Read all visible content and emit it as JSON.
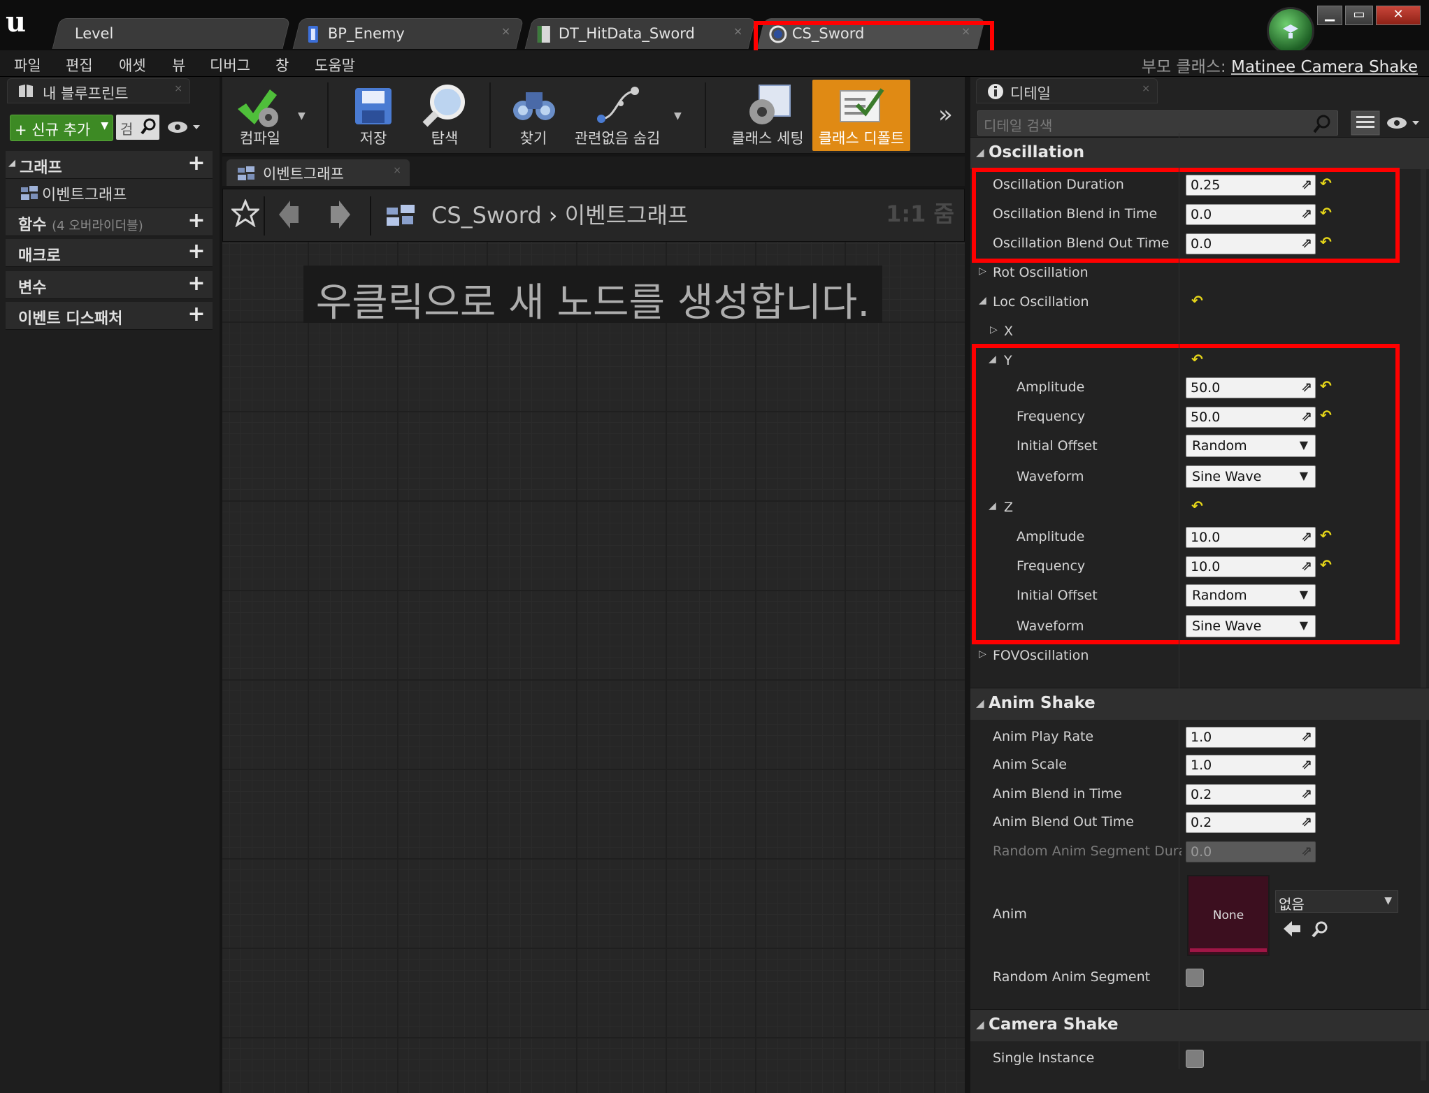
{
  "tabs": [
    {
      "label": "Level",
      "active": false
    },
    {
      "label": "BP_Enemy",
      "active": false
    },
    {
      "label": "DT_HitData_Sword",
      "active": false
    },
    {
      "label": "CS_Sword",
      "active": true
    }
  ],
  "menu": [
    "파일",
    "편집",
    "애셋",
    "뷰",
    "디버그",
    "창",
    "도움말"
  ],
  "parent_class": {
    "label": "부모 클래스:",
    "value": "Matinee Camera Shake"
  },
  "left_panel": {
    "tab_label": "내 블루프린트",
    "add_new": "+ 신규 추가",
    "search_placeholder": "검",
    "categories": [
      {
        "label": "그래프"
      },
      {
        "label": "이벤트그래프",
        "child": true
      },
      {
        "label": "함수",
        "sub": "(4 오버라이더블)"
      },
      {
        "label": "매크로"
      },
      {
        "label": "변수"
      },
      {
        "label": "이벤트 디스패처"
      }
    ]
  },
  "toolbar": [
    {
      "label": "컴파일"
    },
    {
      "label": "저장"
    },
    {
      "label": "탐색"
    },
    {
      "label": "찾기"
    },
    {
      "label": "관련없음 숨김"
    },
    {
      "label": "클래스 세팅"
    },
    {
      "label": "클래스 디폴트"
    }
  ],
  "graph": {
    "tab_label": "이벤트그래프",
    "breadcrumb_root": "CS_Sword",
    "breadcrumb_sep": "›",
    "breadcrumb_leaf": "이벤트그래프",
    "zoom": "1:1 줌",
    "hint": "우클릭으로 새 노드를 생성합니다."
  },
  "details": {
    "tab_label": "디테일",
    "search_placeholder": "디테일 검색",
    "oscillation": {
      "header": "Oscillation",
      "duration_label": "Oscillation Duration",
      "duration": "0.25",
      "blend_in_label": "Oscillation Blend in Time",
      "blend_in": "0.0",
      "blend_out_label": "Oscillation Blend Out Time",
      "blend_out": "0.0",
      "rot_label": "Rot Oscillation",
      "loc_label": "Loc Oscillation",
      "x_label": "X",
      "y_label": "Y",
      "y_amplitude_label": "Amplitude",
      "y_amplitude": "50.0",
      "y_frequency_label": "Frequency",
      "y_frequency": "50.0",
      "y_initial_offset_label": "Initial Offset",
      "y_initial_offset": "Random",
      "y_waveform_label": "Waveform",
      "y_waveform": "Sine Wave",
      "z_label": "Z",
      "z_amplitude_label": "Amplitude",
      "z_amplitude": "10.0",
      "z_frequency_label": "Frequency",
      "z_frequency": "10.0",
      "z_initial_offset_label": "Initial Offset",
      "z_initial_offset": "Random",
      "z_waveform_label": "Waveform",
      "z_waveform": "Sine Wave",
      "fov_label": "FOVOscillation"
    },
    "anim_shake": {
      "header": "Anim Shake",
      "play_rate_label": "Anim Play Rate",
      "play_rate": "1.0",
      "scale_label": "Anim Scale",
      "scale": "1.0",
      "blend_in_label": "Anim Blend in Time",
      "blend_in": "0.2",
      "blend_out_label": "Anim Blend Out Time",
      "blend_out": "0.2",
      "random_segment_duration_label": "Random Anim Segment Duratio",
      "random_segment_duration": "0.0",
      "anim_label": "Anim",
      "anim_thumb": "None",
      "anim_value": "없음",
      "random_segment_label": "Random Anim Segment"
    },
    "camera_shake": {
      "header": "Camera Shake",
      "single_instance_label": "Single Instance"
    }
  }
}
